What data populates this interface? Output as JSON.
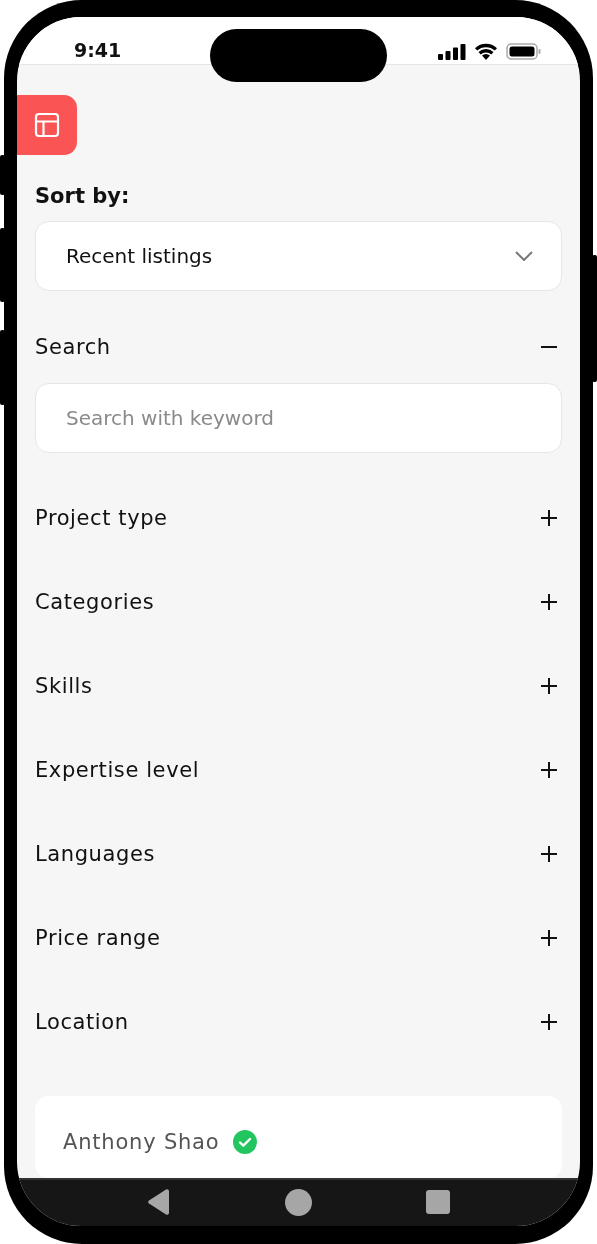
{
  "status_bar": {
    "time": "9:41"
  },
  "sort": {
    "label": "Sort by:",
    "value": "Recent listings"
  },
  "search": {
    "label": "Search",
    "expanded": true,
    "placeholder": "Search with keyword"
  },
  "filters": [
    {
      "label": "Project type",
      "expanded": false
    },
    {
      "label": "Categories",
      "expanded": false
    },
    {
      "label": "Skills",
      "expanded": false
    },
    {
      "label": "Expertise level",
      "expanded": false
    },
    {
      "label": "Languages",
      "expanded": false
    },
    {
      "label": "Price range",
      "expanded": false
    },
    {
      "label": "Location",
      "expanded": false
    }
  ],
  "listing": {
    "author": "Anthony Shao",
    "verified": true
  }
}
